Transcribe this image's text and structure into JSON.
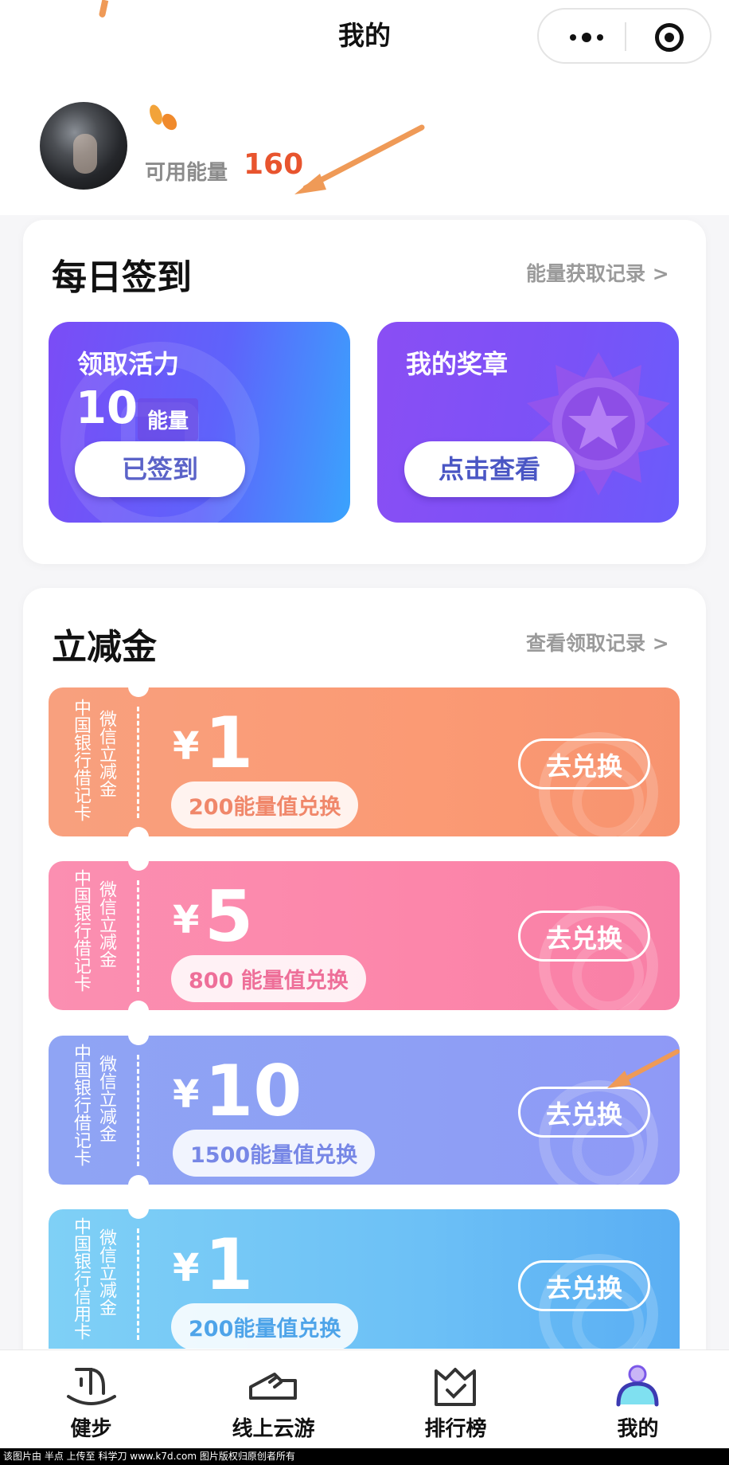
{
  "header": {
    "title": "我的"
  },
  "profile": {
    "energy_label": "可用能量",
    "energy_value": "160"
  },
  "checkin": {
    "title": "每日签到",
    "record_link": "能量获取记录 >",
    "claim_tile": {
      "title": "领取活力",
      "amount": "10",
      "unit": "能量",
      "button": "已签到"
    },
    "medal_tile": {
      "title": "我的奖章",
      "button": "点击查看"
    }
  },
  "discount": {
    "title": "立减金",
    "record_link": "查看领取记录 >",
    "coupons": [
      {
        "side_left": "中国银行借记卡",
        "side_right": "微信立减金",
        "yen": "¥",
        "amount": "1",
        "cost": "200能量值兑换",
        "button": "去兑换",
        "accent": "#f58b62"
      },
      {
        "side_left": "中国银行借记卡",
        "side_right": "微信立减金",
        "yen": "¥",
        "amount": "5",
        "cost": "800 能量值兑换",
        "button": "去兑换",
        "accent": "#f2719b"
      },
      {
        "side_left": "中国银行借记卡",
        "side_right": "微信立减金",
        "yen": "¥",
        "amount": "10",
        "cost": "1500能量值兑换",
        "button": "去兑换",
        "accent": "#7f8ff0"
      },
      {
        "side_left": "中国银行信用卡",
        "side_right": "微信立减金",
        "yen": "¥",
        "amount": "1",
        "cost": "200能量值兑换",
        "button": "去兑换",
        "accent": "#4aa6ee"
      }
    ]
  },
  "nav": {
    "items": [
      {
        "label": "健步",
        "icon": "walking-icon"
      },
      {
        "label": "线上云游",
        "icon": "shoe-icon"
      },
      {
        "label": "排行榜",
        "icon": "crown-ranking-icon"
      },
      {
        "label": "我的",
        "icon": "profile-icon"
      }
    ]
  },
  "footer": {
    "text": "该图片由 半点 上传至 科学刀 www.k7d.com 图片版权归原创者所有"
  },
  "colors": {
    "energy": "#e8542e",
    "annotation_arrow": "#ef9a57",
    "checkin_btn_text": "#5b63c8"
  }
}
